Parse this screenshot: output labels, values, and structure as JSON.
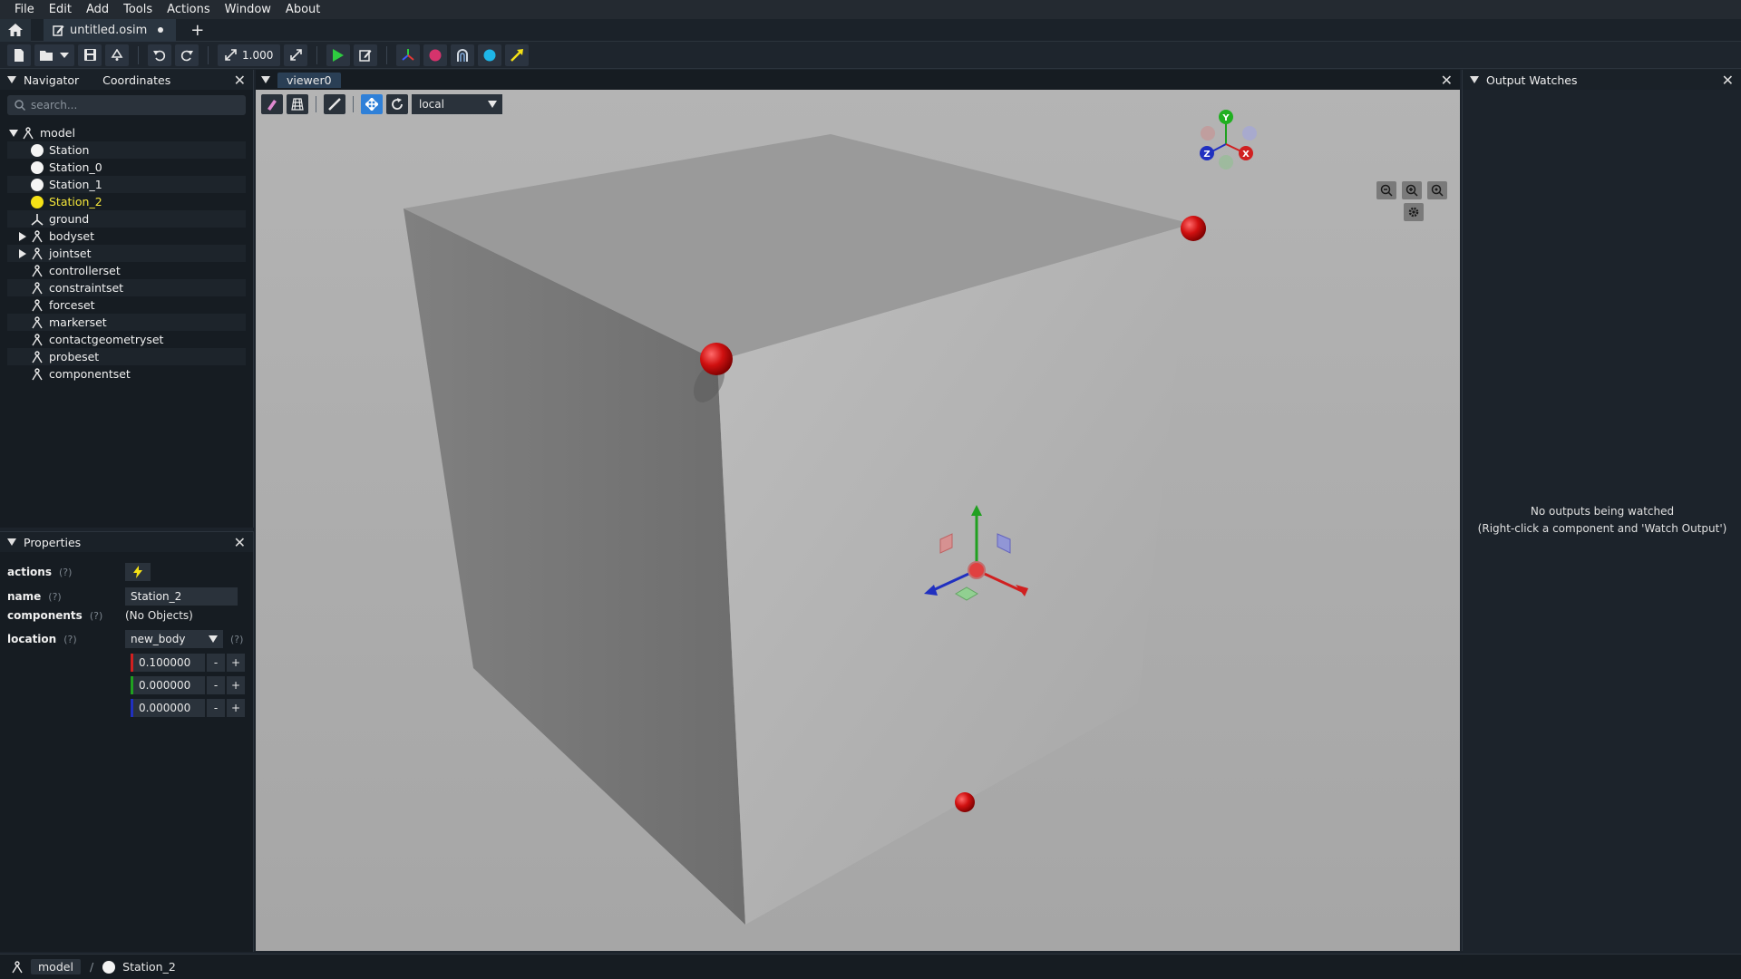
{
  "menu": [
    "File",
    "Edit",
    "Add",
    "Tools",
    "Actions",
    "Window",
    "About"
  ],
  "tabs": [
    {
      "label": "untitled.osim",
      "modified": true
    }
  ],
  "toolbar": {
    "scale_value": "1.000"
  },
  "navigator": {
    "tab_navigator": "Navigator",
    "tab_coordinates": "Coordinates",
    "search_placeholder": "search...",
    "root": "model",
    "items": [
      {
        "label": "Station",
        "icon": "station"
      },
      {
        "label": "Station_0",
        "icon": "station"
      },
      {
        "label": "Station_1",
        "icon": "station"
      },
      {
        "label": "Station_2",
        "icon": "station-selected"
      },
      {
        "label": "ground",
        "icon": "frame"
      },
      {
        "label": "bodyset",
        "icon": "set",
        "expandable": true
      },
      {
        "label": "jointset",
        "icon": "set",
        "expandable": true
      },
      {
        "label": "controllerset",
        "icon": "set"
      },
      {
        "label": "constraintset",
        "icon": "set"
      },
      {
        "label": "forceset",
        "icon": "set"
      },
      {
        "label": "markerset",
        "icon": "set"
      },
      {
        "label": "contactgeometryset",
        "icon": "set"
      },
      {
        "label": "probeset",
        "icon": "set"
      },
      {
        "label": "componentset",
        "icon": "set"
      }
    ]
  },
  "properties": {
    "title": "Properties",
    "help": "(?)",
    "actions_label": "actions",
    "name_label": "name",
    "name_value": "Station_2",
    "components_label": "components",
    "components_value": "(No Objects)",
    "location_label": "location",
    "location_frame": "new_body",
    "location_x": "0.100000",
    "location_y": "0.000000",
    "location_z": "0.000000",
    "minus": "-",
    "plus": "+"
  },
  "viewer": {
    "tab_label": "viewer0",
    "frame_mode": "local",
    "axis_labels": {
      "x": "X",
      "y": "Y",
      "z": "Z"
    }
  },
  "watches": {
    "title": "Output Watches",
    "message_line1": "No outputs being watched",
    "message_line2": "(Right-click a component and 'Watch Output')"
  },
  "statusbar": {
    "crumb_model": "model",
    "separator": "/",
    "crumb_selected": "Station_2"
  },
  "colors": {
    "accent": "#2f80d8",
    "selected_text": "#f5e63a",
    "marker_red": "#d01010",
    "axis_x": "#d02020",
    "axis_y": "#20a020",
    "axis_z": "#2030c0"
  }
}
